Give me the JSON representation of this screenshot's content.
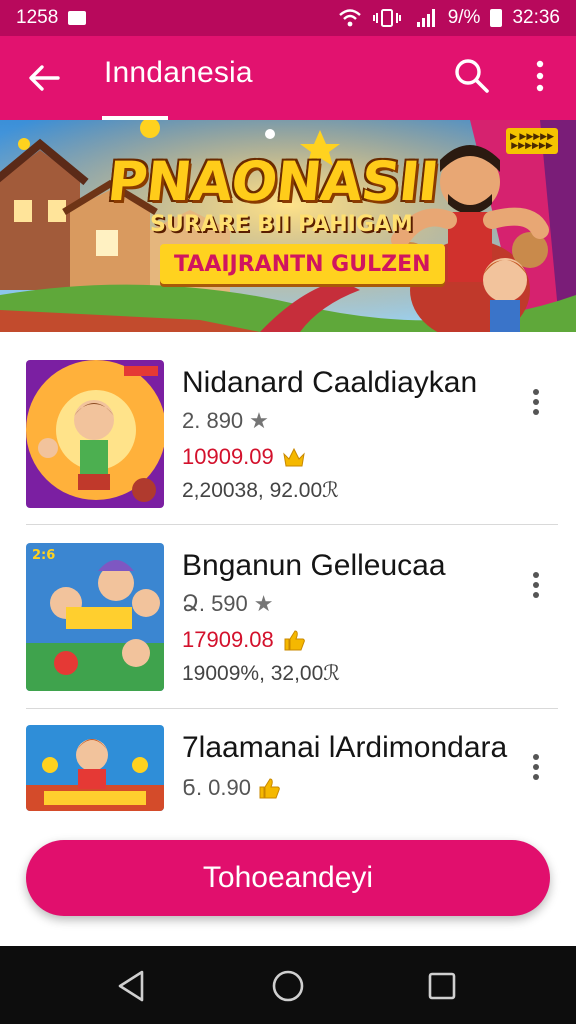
{
  "status_bar": {
    "time": "1258",
    "right_text": "9/% ",
    "clock": "32:36",
    "icons": [
      "wifi-icon",
      "vibrate-icon",
      "signal-icon",
      "battery-icon"
    ]
  },
  "app_bar": {
    "title": "Inndanesia",
    "icons": [
      "back-arrow-icon",
      "search-icon",
      "more-vert-icon"
    ]
  },
  "banner": {
    "title": "PNAONASII",
    "subtitle": "SURARE BII PAHIGAM",
    "ribbon": "TAAIJRANTN GULZEN",
    "badge": "▶ ▶▶▶▶▶ ▶▶▶▶▶▶"
  },
  "items": [
    {
      "name": "Nidanard Caaldiaykan",
      "rating": "2. 890",
      "price": "10909.09",
      "meta": "2,20038, 92.00ℛ"
    },
    {
      "name": "Bnganun Gelleucaa",
      "rating": "Ձ. 590",
      "price": "17909.08",
      "meta": "19009%, 32,00ℛ"
    },
    {
      "name": "7laamanai lArdimondara",
      "rating": "Ნ. 0.90",
      "price": "",
      "meta": ""
    }
  ],
  "cta": {
    "label": "Tohoeandeyi"
  },
  "colors": {
    "primary": "#e2126f",
    "status": "#b8095c",
    "price": "#d3112c"
  }
}
